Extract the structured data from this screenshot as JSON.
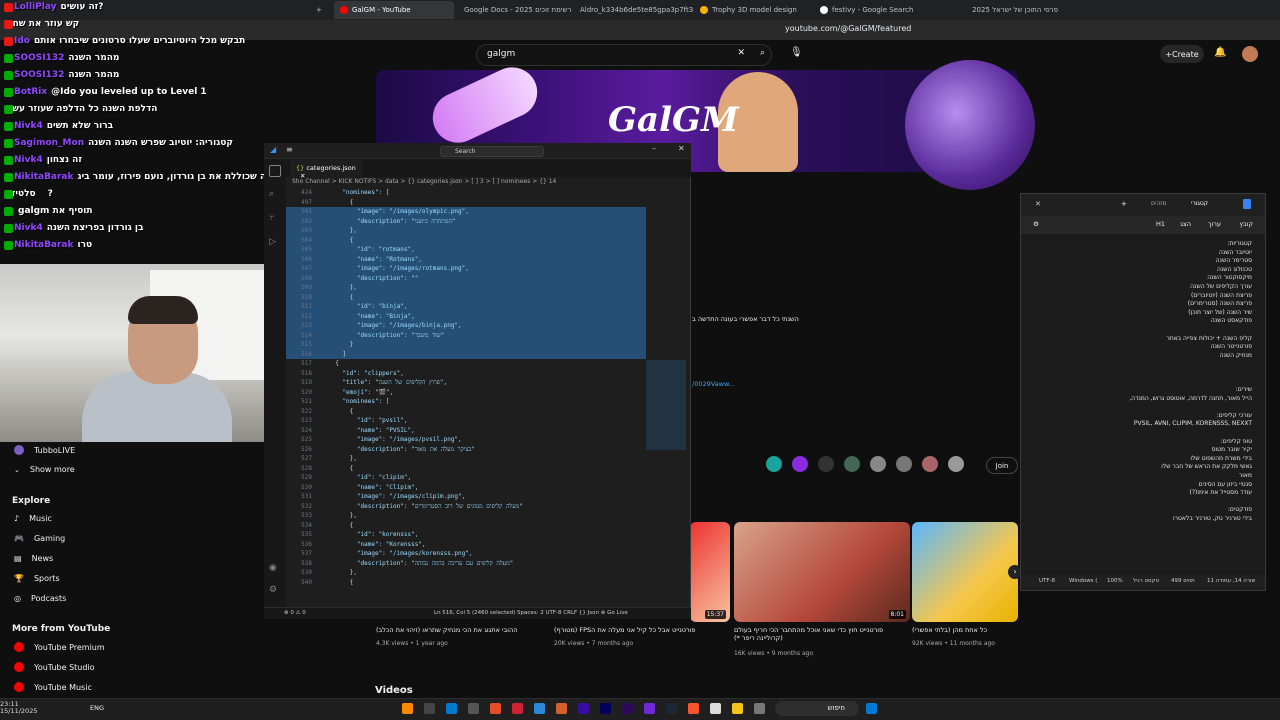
{
  "browser": {
    "tabs": [
      {
        "label": "2025 פרסי התוכן של ישראל",
        "active": false
      },
      {
        "label": "GalGM - YouTube",
        "active": true
      },
      {
        "label": "Google Docs - 2025 רשימת זוכים",
        "active": false
      },
      {
        "label": "Aldro_k334b6de5te85gpa3p7ft3M",
        "active": false
      },
      {
        "label": "Trophy 3D model design",
        "active": false
      },
      {
        "label": "festivy - Google Search",
        "active": false
      }
    ],
    "url": "youtube.com/@GalGM/featured"
  },
  "youtube": {
    "search_value": "galgm",
    "create_label": "Create",
    "banner_title": "GalGM",
    "brand_label": "YouTube",
    "sidebar": {
      "channel_label": "TubboLIVE",
      "show_more": "Show more",
      "explore_head": "Explore",
      "explore_items": [
        "Music",
        "Gaming",
        "News",
        "Sports",
        "Podcasts"
      ],
      "more_head": "More from YouTube",
      "more_items": [
        "YouTube Premium",
        "YouTube Studio",
        "YouTube Music"
      ]
    },
    "join_label": "Join",
    "about_text": "השנתי כל דבר אפשרי בעונה החדשה ב",
    "link_text": "/0029Vaww...",
    "videos_head": "Videos",
    "videos": [
      {
        "title": "ההובי אתגוג את הכי מנחיק שתראו (זיהוי את הכלב)",
        "meta": "4.3K views • 1 year ago",
        "duration": "15:37"
      },
      {
        "title": "(מטורף) FPSפורטנייט אבל כל קיל אני מעלה את ה",
        "meta": "20K views • 7 months ago",
        "duration": "8:01"
      },
      {
        "title": "פורטנייט חוץ כדי שאני אוכל מהתחבר הכי חריף בעולם (קרוליינה ריפר *)",
        "meta": "16K views • 9 months ago",
        "duration": ""
      },
      {
        "title": "כל אחת מהן (בלתי אפשרי)",
        "meta": "92K views • 11 months ago",
        "duration": ""
      }
    ]
  },
  "chat": [
    {
      "user": "LolliPlay",
      "text": "זה עושים?",
      "badge": "#e91916"
    },
    {
      "user": "",
      "text": "קש עוזר את שחק",
      "badge": "#e91916"
    },
    {
      "user": "Ido",
      "text": "תבקש מכל היוטיוברים שעלו סרטונים שיבחרו אותם",
      "badge": "#e91916"
    },
    {
      "user": "SOOSI132",
      "text": "מהמר השנה",
      "badge": "#00ad03"
    },
    {
      "user": "SOOSI132",
      "text": "מהמר השנה",
      "badge": "#00ad03"
    },
    {
      "user": "BotRix",
      "text": "@Ido you leveled up to Level 1",
      "badge": "#00ad03"
    },
    {
      "user": "",
      "text": "הדלפת השנה כל הדלפה שעוזר עשה",
      "badge": "#00ad03"
    },
    {
      "user": "Nivk4",
      "text": "ברור שלא תשים",
      "badge": "#00ad03"
    },
    {
      "user": "Sagimon_Mon",
      "text": "קטגוריה: יוטיוב שפרש השנה השנה",
      "badge": "#00ad03"
    },
    {
      "user": "Nivk4",
      "text": "זה נצחון",
      "badge": "#00ad03"
    },
    {
      "user": "NikitaBarak",
      "text": "לך קטגוריה שכוללת את בן גורדון, נועם פירוז, עומר ביג,",
      "badge": "#00ad03"
    },
    {
      "user": "",
      "text": "סלטיזיו?",
      "badge": "#00ad03"
    },
    {
      "user": "",
      "text": "galgm תוסיף את",
      "badge": "#00ad03"
    },
    {
      "user": "Nivk4",
      "text": "בן גורדון בפריצת השנה",
      "badge": "#00ad03"
    },
    {
      "user": "NikitaBarak",
      "text": "טרו",
      "badge": "#00ad03"
    }
  ],
  "vscode": {
    "search": "Search",
    "tab_label": "categories.json",
    "breadcrumb": "Sho Channel > KICK NOTIFS > data > {} categories.json > [ ] 3 > [ ] nominees > {} 14",
    "status_left": "⊗ 0 ⚠ 0",
    "status_right": "Ln 516, Col 5 (2460 selected)   Spaces: 2   UTF-8   CRLF   {} Json   ⊕ Go Live",
    "code": [
      {
        "ln": "424",
        "text": "    \"nominees\": [",
        "sel": false
      },
      {
        "ln": "497",
        "text": "      {",
        "sel": false
      },
      {
        "ln": "501",
        "text": "        \"image\": \"/images/olympic.png\",",
        "sel": true
      },
      {
        "ln": "502",
        "text": "        \"description\": \"המתחרה כיועני\"",
        "sel": true
      },
      {
        "ln": "503",
        "text": "      },",
        "sel": true
      },
      {
        "ln": "504",
        "text": "      {",
        "sel": true
      },
      {
        "ln": "505",
        "text": "        \"id\": \"rotmans\",",
        "sel": true
      },
      {
        "ln": "506",
        "text": "        \"name\": \"Rotmans\",",
        "sel": true
      },
      {
        "ln": "507",
        "text": "        \"image\": \"/images/rotmans.png\",",
        "sel": true
      },
      {
        "ln": "508",
        "text": "        \"description\": \"\"",
        "sel": true
      },
      {
        "ln": "509",
        "text": "      },",
        "sel": true
      },
      {
        "ln": "510",
        "text": "      {",
        "sel": true
      },
      {
        "ln": "511",
        "text": "        \"id\": \"binja\",",
        "sel": true
      },
      {
        "ln": "512",
        "text": "        \"name\": \"Binja\",",
        "sel": true
      },
      {
        "ln": "513",
        "text": "        \"image\": \"/images/binja.png\",",
        "sel": true
      },
      {
        "ln": "514",
        "text": "        \"description\": \"שוד משבר\"",
        "sel": true
      },
      {
        "ln": "515",
        "text": "      }",
        "sel": true
      },
      {
        "ln": "516",
        "text": "    ]",
        "sel": true
      },
      {
        "ln": "517",
        "text": "  {",
        "sel": false
      },
      {
        "ln": "518",
        "text": "    \"id\": \"clippers\",",
        "sel": false
      },
      {
        "ln": "519",
        "text": "    \"title\": \"פרוץ הקליפים של השנה\",",
        "sel": false
      },
      {
        "ln": "520",
        "text": "    \"emoji\": \"🎬\",",
        "sel": false
      },
      {
        "ln": "521",
        "text": "    \"nominees\": [",
        "sel": false
      },
      {
        "ln": "522",
        "text": "      {",
        "sel": false
      },
      {
        "ln": "523",
        "text": "        \"id\": \"pvsil\",",
        "sel": false
      },
      {
        "ln": "524",
        "text": "        \"name\": \"PVSIL\",",
        "sel": false
      },
      {
        "ln": "525",
        "text": "        \"image\": \"/images/pvsil.png\",",
        "sel": false
      },
      {
        "ln": "526",
        "text": "        \"description\": \"בציקר מעלה את מאור\"",
        "sel": false
      },
      {
        "ln": "527",
        "text": "      },",
        "sel": false
      },
      {
        "ln": "528",
        "text": "      {",
        "sel": false
      },
      {
        "ln": "529",
        "text": "        \"id\": \"clipim\",",
        "sel": false
      },
      {
        "ln": "530",
        "text": "        \"name\": \"Clipim\",",
        "sel": false
      },
      {
        "ln": "531",
        "text": "        \"image\": \"/images/clipim.png\",",
        "sel": false
      },
      {
        "ln": "532",
        "text": "        \"description\": \"מעלה קליפים מגוונים של רוב הסטרימרים\"",
        "sel": false
      },
      {
        "ln": "533",
        "text": "      },",
        "sel": false
      },
      {
        "ln": "534",
        "text": "      {",
        "sel": false
      },
      {
        "ln": "535",
        "text": "        \"id\": \"korensss\",",
        "sel": false
      },
      {
        "ln": "536",
        "text": "        \"name\": \"Korensss\",",
        "sel": false
      },
      {
        "ln": "537",
        "text": "        \"image\": \"/images/korensss.png\",",
        "sel": false
      },
      {
        "ln": "538",
        "text": "        \"description\": \"מעלה קליפים עם עריכה ברמה גבוהה\"",
        "sel": false
      },
      {
        "ln": "539",
        "text": "      },",
        "sel": false
      },
      {
        "ln": "540",
        "text": "      {",
        "sel": false
      }
    ]
  },
  "notepad": {
    "tab_label": "קטגורי",
    "tab2_label": "מזהים",
    "menu": [
      "קובץ",
      "ערוך",
      "הצג",
      "H1"
    ],
    "lines": [
      "קטגוריות:",
      "יוטיובר השנה",
      "סטרימר השנה",
      "טכנולוג השנה",
      "מיקסוקטור השנה",
      "עורך הקליפים של השנה",
      "פריצת השנה (יוטיוברים)",
      "פריצת השנה (סטרימרים)",
      "שיר השנה (של יוצר תוכן)",
      "פודקאסט השנה",
      "",
      "קליפ השנה + יכולות צפייה באתר",
      "פורטנייטר השנה",
      "מנחיק השנה",
      "",
      "",
      "",
      "שירים:",
      "הייל מאור, תחנה לדרמה, אוטוסט גרוש, המנדה,",
      "",
      "עורכי קליפים:",
      "PVSIL, AVNI, CLIPIM, KORENSSS, NEXXT",
      "",
      "טופ קליפים:",
      "יקיר שובר מטוס",
      "בידי משרת מהשפוט שלו",
      "גאשי מלקק את הראש של חבר שלו",
      "מאור",
      "סנטיי ביזון עם הסינים",
      "עודד מסטייל את אימו(?)",
      "",
      "פודקטים:",
      "בידי טורניר טק, טורניר בלאטרו"
    ],
    "status": [
      "UTF-8",
      "Windows (",
      "100%",
      "טקסט רגיל",
      "499 תווים",
      "שורה 14, עמודה 11"
    ]
  },
  "taskbar": {
    "time": "23:11",
    "date": "15/11/2025",
    "lang": "ENG",
    "search": "חיפוש"
  }
}
